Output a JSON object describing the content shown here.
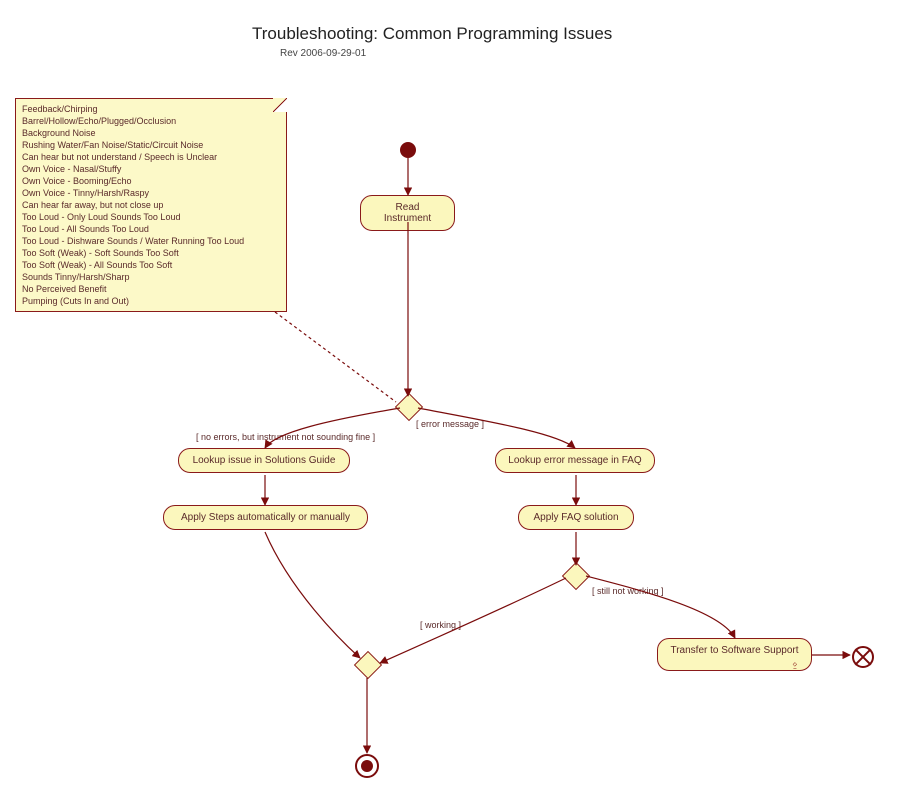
{
  "title": "Troubleshooting: Common Programming Issues",
  "revision": "Rev 2006-09-29-01",
  "note_items": [
    "Feedback/Chirping",
    "Barrel/Hollow/Echo/Plugged/Occlusion",
    "Background Noise",
    "Rushing Water/Fan Noise/Static/Circuit Noise",
    "Can hear but not understand / Speech is Unclear",
    "Own Voice - Nasal/Stuffy",
    "Own Voice - Booming/Echo",
    "Own Voice - Tinny/Harsh/Raspy",
    "Can hear far away, but not close up",
    "Too Loud - Only Loud Sounds Too Loud",
    "Too Loud - All Sounds Too Loud",
    "Too Loud - Dishware Sounds / Water Running Too Loud",
    "Too Soft (Weak) - Soft Sounds Too Soft",
    "Too Soft (Weak) - All Sounds Too Soft",
    "Sounds Tinny/Harsh/Sharp",
    "No Perceived Benefit",
    "Pumping (Cuts In and Out)"
  ],
  "activities": {
    "read_instrument": "Read Instrument",
    "lookup_solutions_guide": "Lookup issue in Solutions Guide",
    "lookup_faq": "Lookup error message in FAQ",
    "apply_steps": "Apply Steps automatically or manually",
    "apply_faq": "Apply FAQ solution",
    "transfer_support": "Transfer to Software Support"
  },
  "guards": {
    "error_message": "[ error message ]",
    "no_errors": "[ no errors, but instrument not sounding fine ]",
    "still_not_working": "[ still not working ]",
    "working": "[ working ]"
  },
  "colors": {
    "node_fill": "#fbf7bd",
    "node_border": "#8a1a1a",
    "note_fill": "#fcf9c8",
    "edge": "#7a0c0c"
  }
}
